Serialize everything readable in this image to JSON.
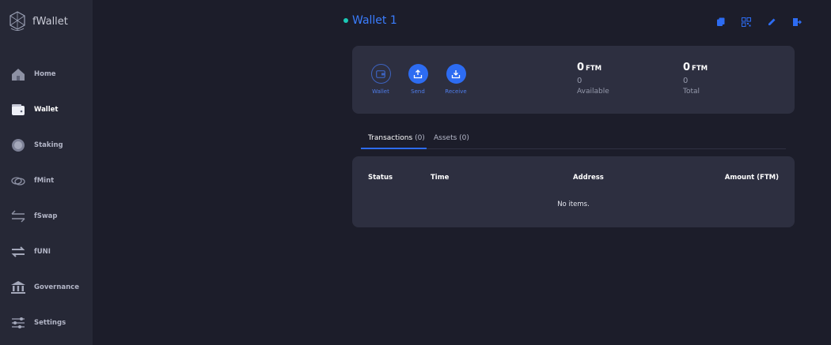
{
  "app": {
    "name": "fWallet"
  },
  "sidebar": {
    "items": [
      {
        "label": "Home",
        "icon": "home-icon"
      },
      {
        "label": "Wallet",
        "icon": "wallet-icon"
      },
      {
        "label": "Staking",
        "icon": "staking-icon"
      },
      {
        "label": "fMint",
        "icon": "fmint-icon"
      },
      {
        "label": "fSwap",
        "icon": "fswap-icon"
      },
      {
        "label": "fUNI",
        "icon": "funi-icon"
      },
      {
        "label": "Governance",
        "icon": "governance-icon"
      },
      {
        "label": "Settings",
        "icon": "settings-icon"
      }
    ],
    "active": "Wallet"
  },
  "header": {
    "wallet_name": "Wallet 1",
    "status_color": "#1bc9b6",
    "actions": [
      "copy-icon",
      "qr-code-icon",
      "edit-icon",
      "logout-icon"
    ]
  },
  "balance_card": {
    "actions": [
      {
        "label": "Wallet",
        "icon": "wallet-icon"
      },
      {
        "label": "Send",
        "icon": "send-icon"
      },
      {
        "label": "Receive",
        "icon": "receive-icon"
      }
    ],
    "available": {
      "amount": "0",
      "currency": "FTM",
      "fiat": "0",
      "label": "Available"
    },
    "total": {
      "amount": "0",
      "currency": "FTM",
      "fiat": "0",
      "label": "Total"
    }
  },
  "tabs": [
    {
      "label": "Transactions",
      "count": "(0)"
    },
    {
      "label": "Assets",
      "count": "(0)"
    }
  ],
  "table": {
    "columns": [
      "Status",
      "Time",
      "Address",
      "Amount (FTM)"
    ],
    "empty_text": "No items."
  },
  "colors": {
    "accent": "#2d6cf2",
    "background": "#1c1d2a",
    "sidebar": "#262836",
    "card": "#2d2f40"
  }
}
